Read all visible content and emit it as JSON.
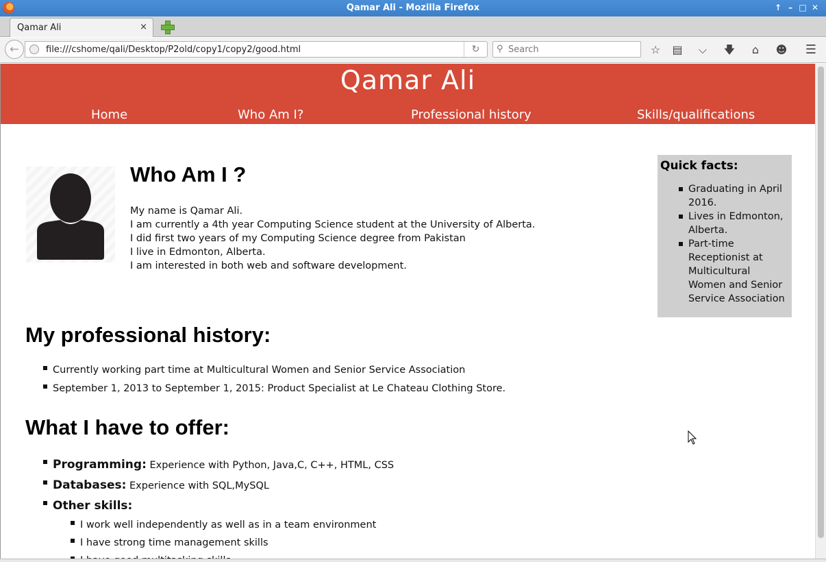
{
  "window": {
    "title": "Qamar Ali - Mozilla Firefox",
    "controls": [
      "↑",
      "–",
      "□",
      "✕"
    ]
  },
  "tabs": [
    {
      "label": "Qamar Ali",
      "close": "×"
    }
  ],
  "navbar": {
    "url": "file:///cshome/qali/Desktop/P2old/copy1/copy2/good.html",
    "search_placeholder": "Search"
  },
  "site": {
    "title": "Qamar Ali",
    "nav": [
      "Home",
      "Who Am I?",
      "Professional history",
      "Skills/qualifications"
    ],
    "header_color": "#d64a38"
  },
  "who": {
    "heading": "Who Am I ?",
    "bio": [
      "My name is Qamar Ali.",
      "I am currently a 4th year Computing Science student at the University of Alberta.",
      "I did first two years of my Computing Science degree from Pakistan",
      "I live in Edmonton, Alberta.",
      "I am interested in both web and software development."
    ]
  },
  "facts": {
    "title": "Quick facts:",
    "items": [
      "Graduating in April 2016.",
      "Lives in Edmonton, Alberta.",
      "Part-time Receptionist at Multicultural Women and Senior Service Association"
    ]
  },
  "history": {
    "heading": "My professional history:",
    "items": [
      "Currently working part time at Multicultural Women and Senior Service Association",
      "September 1, 2013 to September 1, 2015: Product Specialist at Le Chateau Clothing Store."
    ]
  },
  "offer": {
    "heading": "What I have to offer:",
    "skills": [
      {
        "label": "Programming:",
        "detail": "Experience with Python, Java,C, C++, HTML, CSS"
      },
      {
        "label": "Databases:",
        "detail": "Experience with SQL,MySQL"
      },
      {
        "label": "Other skills:",
        "detail": ""
      }
    ],
    "other": [
      "I work well independently as well as in a team environment",
      "I have strong time management skills",
      "I have good multitasking skills"
    ]
  }
}
